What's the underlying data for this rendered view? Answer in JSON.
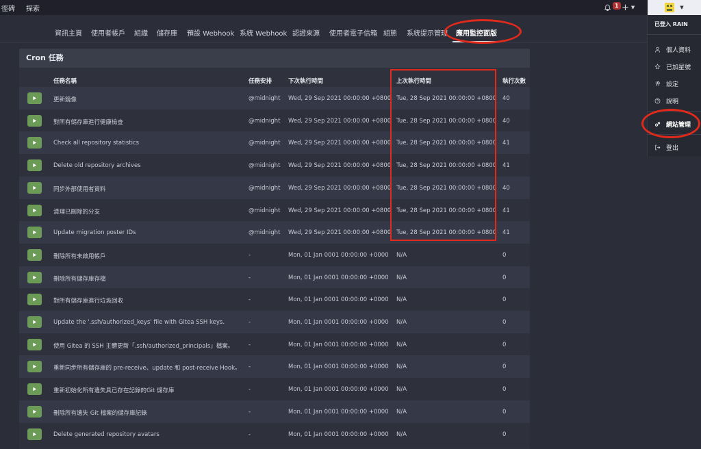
{
  "topnav": {
    "links": [
      "徑碑",
      "探索"
    ],
    "notification_count": "1",
    "plus_label": "+"
  },
  "admin_tabs": [
    "資訊主頁",
    "使用者帳戶",
    "組織",
    "儲存庫",
    "預設 Webhook",
    "系統 Webhook",
    "認證來源",
    "使用者電子信箱",
    "組態",
    "系統提示管理",
    "應用監控面版"
  ],
  "active_tab": "應用監控面版",
  "panel": {
    "title": "Cron 任務",
    "columns": [
      "任務名稱",
      "任務安排",
      "下次執行時間",
      "上次執行時間",
      "執行次數"
    ],
    "rows": [
      {
        "name": "更新鏡像",
        "schedule": "@midnight",
        "next": "Wed, 29 Sep 2021 00:00:00 +0800",
        "prev": "Tue, 28 Sep 2021 00:00:00 +0800",
        "execs": "40"
      },
      {
        "name": "對所有儲存庫進行健康檢查",
        "schedule": "@midnight",
        "next": "Wed, 29 Sep 2021 00:00:00 +0800",
        "prev": "Tue, 28 Sep 2021 00:00:00 +0800",
        "execs": "40"
      },
      {
        "name": "Check all repository statistics",
        "schedule": "@midnight",
        "next": "Wed, 29 Sep 2021 00:00:00 +0800",
        "prev": "Tue, 28 Sep 2021 00:00:00 +0800",
        "execs": "41"
      },
      {
        "name": "Delete old repository archives",
        "schedule": "@midnight",
        "next": "Wed, 29 Sep 2021 00:00:00 +0800",
        "prev": "Tue, 28 Sep 2021 00:00:00 +0800",
        "execs": "41"
      },
      {
        "name": "同步外部使用者資料",
        "schedule": "@midnight",
        "next": "Wed, 29 Sep 2021 00:00:00 +0800",
        "prev": "Tue, 28 Sep 2021 00:00:00 +0800",
        "execs": "40"
      },
      {
        "name": "清理已刪除的分支",
        "schedule": "@midnight",
        "next": "Wed, 29 Sep 2021 00:00:00 +0800",
        "prev": "Tue, 28 Sep 2021 00:00:00 +0800",
        "execs": "41"
      },
      {
        "name": "Update migration poster IDs",
        "schedule": "@midnight",
        "next": "Wed, 29 Sep 2021 00:00:00 +0800",
        "prev": "Tue, 28 Sep 2021 00:00:00 +0800",
        "execs": "41"
      },
      {
        "name": "刪除所有未啟用帳戶",
        "schedule": "-",
        "next": "Mon, 01 Jan 0001 00:00:00 +0000",
        "prev": "N/A",
        "execs": "0"
      },
      {
        "name": "刪除所有儲存庫存檔",
        "schedule": "-",
        "next": "Mon, 01 Jan 0001 00:00:00 +0000",
        "prev": "N/A",
        "execs": "0"
      },
      {
        "name": "對所有儲存庫進行垃圾回收",
        "schedule": "-",
        "next": "Mon, 01 Jan 0001 00:00:00 +0000",
        "prev": "N/A",
        "execs": "0"
      },
      {
        "name": "Update the '.ssh/authorized_keys' file with Gitea SSH keys.",
        "schedule": "-",
        "next": "Mon, 01 Jan 0001 00:00:00 +0000",
        "prev": "N/A",
        "execs": "0"
      },
      {
        "name": "使用 Gitea 的 SSH 主體更新「.ssh/authorized_principals」檔案。",
        "schedule": "-",
        "next": "Mon, 01 Jan 0001 00:00:00 +0000",
        "prev": "N/A",
        "execs": "0"
      },
      {
        "name": "重新同步所有儲存庫的 pre-receive、update 和 post-receive Hook。",
        "schedule": "-",
        "next": "Mon, 01 Jan 0001 00:00:00 +0000",
        "prev": "N/A",
        "execs": "0"
      },
      {
        "name": "重新初始化所有遺失具已存在記錄的Git 儲存庫",
        "schedule": "-",
        "next": "Mon, 01 Jan 0001 00:00:00 +0000",
        "prev": "N/A",
        "execs": "0"
      },
      {
        "name": "刪除所有遺失 Git 檔案的儲存庫記錄",
        "schedule": "-",
        "next": "Mon, 01 Jan 0001 00:00:00 +0000",
        "prev": "N/A",
        "execs": "0"
      },
      {
        "name": "Delete generated repository avatars",
        "schedule": "-",
        "next": "Mon, 01 Jan 0001 00:00:00 +0000",
        "prev": "N/A",
        "execs": "0"
      }
    ]
  },
  "dropdown": {
    "header": "已登入 RAIN",
    "items": [
      {
        "label": "個人資料",
        "icon": "user-icon"
      },
      {
        "label": "已加星號",
        "icon": "star-icon"
      },
      {
        "label": "設定",
        "icon": "tools-icon"
      },
      {
        "label": "說明",
        "icon": "question-icon"
      },
      {
        "label": "網站管理",
        "icon": "server-gears-icon"
      },
      {
        "label": "登出",
        "icon": "sign-out-icon"
      }
    ]
  },
  "colors": {
    "run_button": "#6c9a57",
    "annotation": "#e02a1c",
    "badge": "#b03131"
  }
}
